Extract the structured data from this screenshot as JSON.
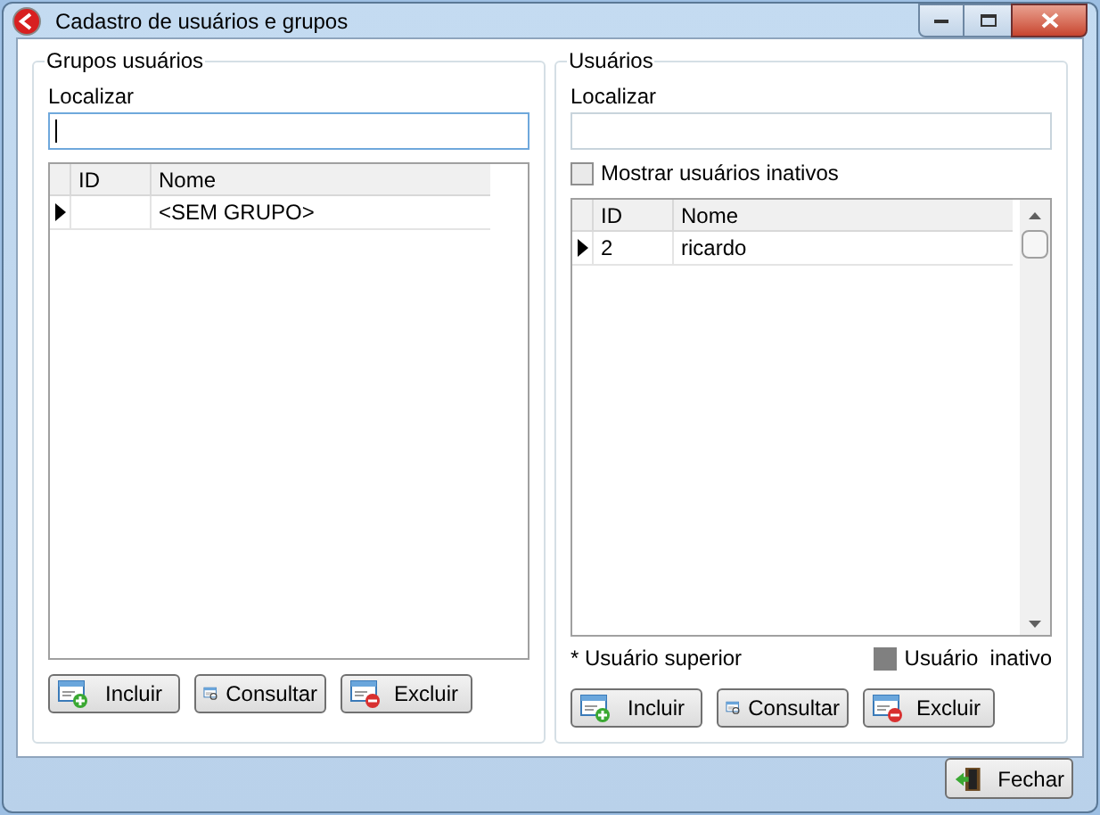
{
  "window": {
    "title": "Cadastro de usuários e grupos"
  },
  "groups_panel": {
    "title": "Grupos usuários",
    "search_label": "Localizar",
    "search_focused": true,
    "grid": {
      "columns": [
        "ID",
        "Nome"
      ],
      "rows": [
        {
          "id": "",
          "name": "<SEM GRUPO>",
          "current": true
        }
      ]
    },
    "buttons": [
      {
        "label": "Incluir",
        "kind": "add"
      },
      {
        "label": "Consultar",
        "kind": "view"
      },
      {
        "label": "Excluir",
        "kind": "delete"
      }
    ]
  },
  "users_panel": {
    "title": "Usuários",
    "search_label": "Localizar",
    "show_inactive": {
      "label": "Mostrar usuários inativos",
      "checked": false
    },
    "grid": {
      "columns": [
        "ID",
        "Nome"
      ],
      "rows": [
        {
          "id": "2",
          "name": "ricardo",
          "current": true
        }
      ]
    },
    "legend_note": "* Usuário superior",
    "legend_inactive": {
      "label": "Usuário  inativo",
      "color": "#808080"
    },
    "buttons": [
      {
        "label": "Incluir",
        "kind": "add"
      },
      {
        "label": "Consultar",
        "kind": "view"
      },
      {
        "label": "Excluir",
        "kind": "delete"
      }
    ]
  },
  "footer": {
    "close_button": "Fechar"
  }
}
